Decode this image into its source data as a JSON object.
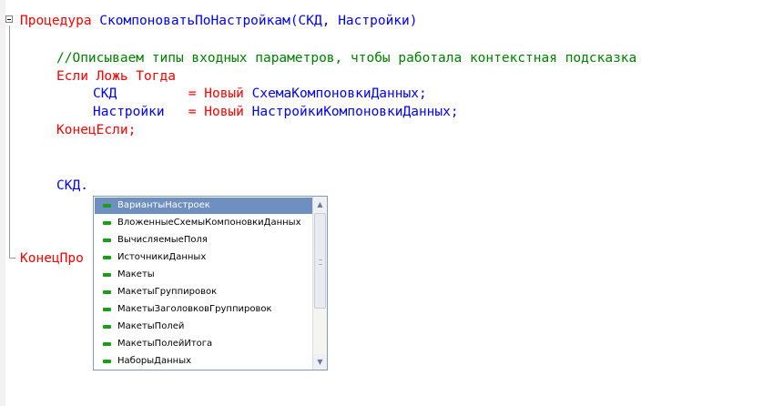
{
  "code": {
    "line1": {
      "keyword": "Процедура",
      "rest": " СкомпоноватьПоНастройкам(СКД, Настройки)"
    },
    "line3": {
      "comment": "//Описываем типы входных параметров, чтобы работала контекстная подсказка"
    },
    "line4": {
      "text": "Если Ложь Тогда"
    },
    "line5": {
      "name": "СКД",
      "spacer": "         ",
      "assign": "= Новый",
      "type": " СхемаКомпоновкиДанных;"
    },
    "line6": {
      "name": "Настройки",
      "spacer": "   ",
      "assign": "= Новый",
      "type": " НастройкиКомпоновкиДанных;"
    },
    "line7": {
      "text": "КонецЕсли;"
    },
    "line10": {
      "text": "СКД."
    },
    "line14": {
      "text": "КонецПро"
    }
  },
  "autocomplete": {
    "selected_index": 0,
    "items": [
      "ВариантыНастроек",
      "ВложенныеСхемыКомпоновкиДанных",
      "ВычисляемыеПоля",
      "ИсточникиДанных",
      "Макеты",
      "МакетыГруппировок",
      "МакетыЗаголовковГруппировок",
      "МакетыПолей",
      "МакетыПолейИтога",
      "НаборыДанных"
    ],
    "item_icon": "property-icon",
    "scroll_up_icon": "▲",
    "scroll_down_icon": "▼"
  },
  "colors": {
    "keyword": "#ff0000",
    "identifier": "#0000ff",
    "comment": "#008000",
    "selection": "#6e8fbf"
  }
}
